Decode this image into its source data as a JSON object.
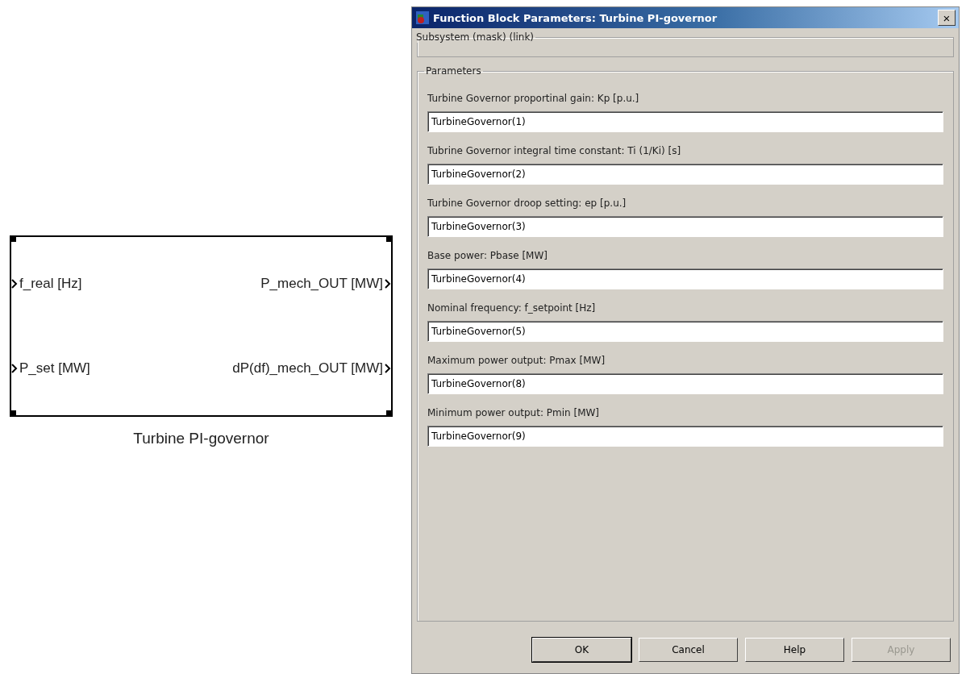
{
  "block": {
    "name": "Turbine PI-governor",
    "inputs": [
      "f_real [Hz]",
      "P_set [MW]"
    ],
    "outputs": [
      "P_mech_OUT [MW]",
      "dP(df)_mech_OUT [MW]"
    ]
  },
  "dialog": {
    "title": "Function Block Parameters: Turbine PI-governor",
    "close": "×",
    "description_group": {
      "title": "Subsystem (mask) (link)"
    },
    "parameters_group": {
      "title": "Parameters",
      "parameters": [
        {
          "label": "Turbine Governor proportinal gain: Kp [p.u.]",
          "value": "TurbineGovernor(1)"
        },
        {
          "label": "Tubrine Governor integral time constant: Ti (1/Ki) [s]",
          "value": "TurbineGovernor(2)"
        },
        {
          "label": "Turbine Governor droop setting: ep [p.u.]",
          "value": "TurbineGovernor(3)"
        },
        {
          "label": "Base power: Pbase [MW]",
          "value": "TurbineGovernor(4)"
        },
        {
          "label": "Nominal frequency: f_setpoint [Hz]",
          "value": "TurbineGovernor(5)"
        },
        {
          "label": "Maximum power output: Pmax [MW]",
          "value": "TurbineGovernor(8)"
        },
        {
          "label": "Minimum power output: Pmin [MW]",
          "value": "TurbineGovernor(9)"
        }
      ]
    },
    "buttons": [
      {
        "label": "OK",
        "disabled": false,
        "default": true
      },
      {
        "label": "Cancel",
        "disabled": false,
        "default": false
      },
      {
        "label": "Help",
        "disabled": false,
        "default": false
      },
      {
        "label": "Apply",
        "disabled": true,
        "default": false
      }
    ]
  }
}
